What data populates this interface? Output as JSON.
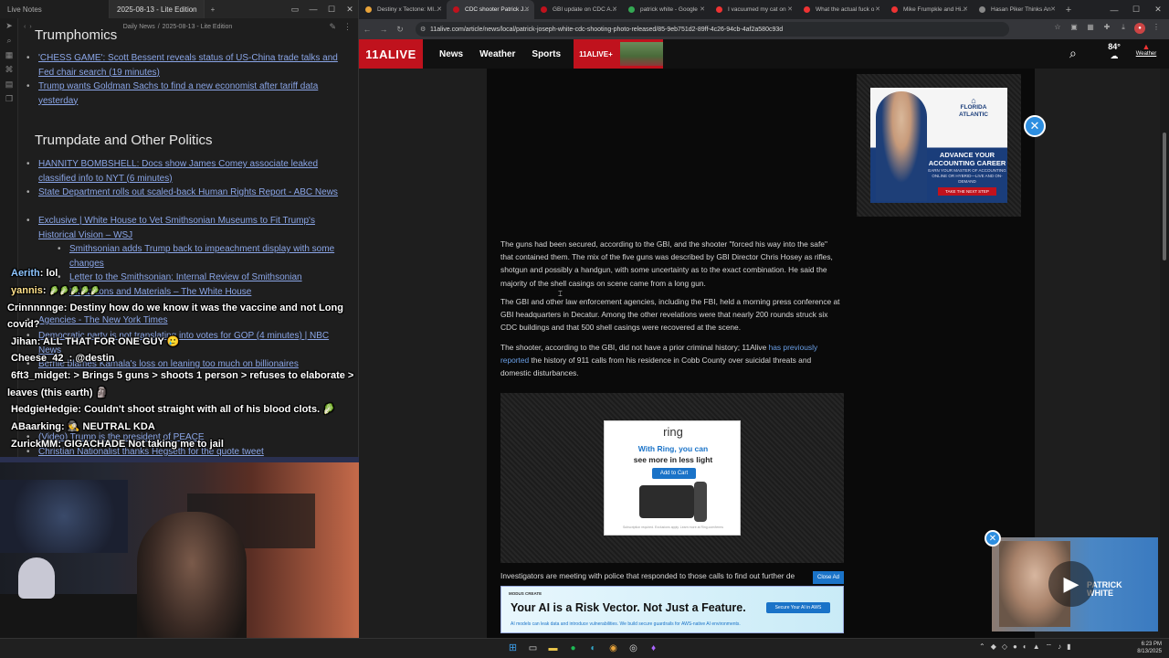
{
  "left_app": {
    "tab1": "Live Notes",
    "tab2": "2025-08-13 - Lite Edition",
    "breadcrumb_1": "Daily News",
    "breadcrumb_sep": "/",
    "breadcrumb_2": "2025-08-13 - Lite Edition",
    "heading_top": "Trumphomics",
    "heading_politics": "Trumpdate and Other Politics",
    "bullets": [
      "'CHESS GAME': Scott Bessent reveals status of US-China trade talks and Fed chair search (19 minutes)",
      "Trump wants Goldman Sachs to find a new economist after tariff data yesterday",
      "HANNITY BOMBSHELL: Docs show James Comey associate leaked classified info to NYT (6 minutes)",
      "State Department rolls out scaled-back Human Rights Report - ABC News",
      "Exclusive | White House to Vet Smithsonian Museums to Fit Trump's Historical Vision – WSJ",
      "Smithsonian adds Trump back to impeachment display with some changes",
      "Letter to the Smithsonian: Internal Review of Smithsonian Exhibitions and Materials – The White House",
      "Agencies - The New York Times",
      "Democratic party is not translating into votes for GOP (4 minutes) | NBC News",
      "Bernie blames Kamala's loss on leaning too much on billionaires",
      "(Video) Trump is the president of PEACE",
      "Christian Nationalist thanks Hegseth for the quote tweet"
    ]
  },
  "chat": [
    {
      "name": "Aerith",
      "msg": "lol"
    },
    {
      "name": "yannis",
      "msg": "🥬🥬🥬🥬🥬"
    },
    {
      "name": "Crinnnnnge",
      "msg": "Destiny how do we know it was the vaccine and not Long"
    },
    {
      "name": "",
      "msg": "covid?"
    },
    {
      "name": "Jihan",
      "msg": "ALL THAT FOR ONE GUY 🥲"
    },
    {
      "name": "Cheese_42_",
      "msg": "@destin"
    },
    {
      "name": "6ft3_midget",
      "msg": "> Brings 5 guns > shoots 1 person > refuses to elaborate >"
    },
    {
      "name": "",
      "msg": "leaves (this earth) 🗿"
    },
    {
      "name": "HedgieHedgie",
      "msg": "Couldn't shoot straight with all of his blood clots. 🥬"
    },
    {
      "name": "ABaarking",
      "msg": "🕵 NEUTRAL KDA"
    },
    {
      "name": "ZurickMM",
      "msg": "GIGACHADE Not taking me to jail"
    }
  ],
  "browser": {
    "tabs": [
      {
        "title": "Destiny x Tectone: MI...",
        "color": "#e8a33a"
      },
      {
        "title": "CDC shooter Patrick J...",
        "color": "#c0121d"
      },
      {
        "title": "GBI update on CDC A...",
        "color": "#c0121d"
      },
      {
        "title": "patrick white - Google",
        "color": "#34a853"
      },
      {
        "title": "I vacuumed my cat on",
        "color": "#e33"
      },
      {
        "title": "What the actual fuck o",
        "color": "#e33"
      },
      {
        "title": "Mike Frumpkle and Hi...",
        "color": "#e33"
      },
      {
        "title": "Hasan Piker Thinks An",
        "color": "#888"
      }
    ],
    "url": "11alive.com/article/news/local/patrick-joseph-white-cdc-shooting-photo-released/85-9eb751d2-89ff-4c26-94cb-4af2a580c93d"
  },
  "site": {
    "logo": "11ALIVE",
    "nav": [
      "News",
      "Weather",
      "Sports"
    ],
    "alive_plus": "11ALIVE+",
    "temp": "84°",
    "weather_label": "Weather"
  },
  "article": {
    "p1": "The guns had been secured, according to the GBI, and the shooter \"forced his way into the safe\" that contained them. The mix of the five guns was described by GBI Director Chris Hosey as rifles, shotgun and possibly a handgun, with some uncertainty as to the exact combination. He said the majority of the shell casings on scene came from a long gun.",
    "p2": "The GBI and other law enforcement agencies, including the FBI, held a morning press conference at GBI headquarters in Decatur. Among the other revelations were that nearly 200 rounds struck six CDC buildings and that 500 shell casings were recovered at the scene.",
    "p3_a": "The shooter, according to the GBI, did not have a prior criminal history; 11Alive ",
    "p3_link": "has previously reported",
    "p3_b": " the history of 911 calls from his residence in Cobb County over suicidal threats and domestic disturbances.",
    "p4": "Investigators are meeting with police that responded to those calls to find out further de"
  },
  "ads": {
    "ring_logo": "ring",
    "ring_head1": "With Ring, you can",
    "ring_head2": "see more in less light",
    "ring_btn": "Add to Cart",
    "ring_fine": "Subscription required. Exclusions apply. Learn more at Ring.com/terms",
    "fl_brand1": "FLORIDA",
    "fl_brand2": "ATLANTIC",
    "fl_t1": "ADVANCE YOUR ACCOUNTING CAREER",
    "fl_t2": "EARN YOUR MASTER OF ACCOUNTING ONLINE OR HYBRID—LIVE AND ON-DEMAND",
    "fl_btn": "TAKE THE NEXT STEP",
    "close_ad": "Close Ad",
    "ai_tag": "MODUS CREATE",
    "ai_head": "Your AI is a Risk Vector. Not Just a Feature.",
    "ai_sub": "AI models can leak data and introduce vulnerabilities. We build secure guardrails for AWS-native AI environments.",
    "ai_btn": "Secure Your AI in AWS",
    "video_name1": "PATRICK",
    "video_name2": "WHITE"
  },
  "taskbar": {
    "time": "6:23 PM",
    "date": "8/13/2025"
  }
}
